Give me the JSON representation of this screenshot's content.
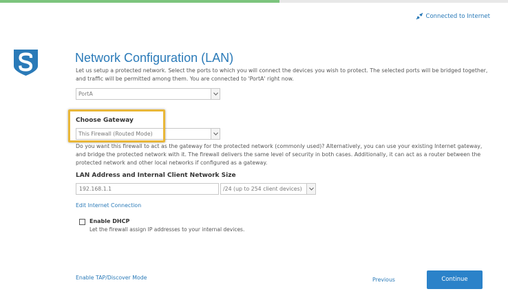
{
  "wizard": {
    "progress_fraction": 0.55
  },
  "header": {
    "connection_status": "Connected to Internet"
  },
  "page": {
    "title": "Network Configuration (LAN)",
    "intro": "Let us setup a protected network. Select the ports to which you will connect the devices you wish to protect. The selected ports will be bridged together, and traffic will be permitted among them. You are connected to 'PortA' right now."
  },
  "ports": {
    "selected": "PortA"
  },
  "gateway": {
    "label": "Choose Gateway",
    "selected": "This Firewall (Routed Mode)",
    "description": "Do you want this firewall to act as the gateway for the protected network (commonly used)? Alternatively, you can use your existing Internet gateway, and bridge the protected network with it. The firewall delivers the same level of security in both cases. Additionally, it can act as a router between the protected network and other local networks if configured as a gateway."
  },
  "lan": {
    "label": "LAN Address and Internal Client Network Size",
    "ip_value": "192.168.1.1",
    "subnet_selected": "/24 (up to 254 client devices)"
  },
  "links": {
    "edit_internet": "Edit Internet Connection",
    "tap_mode": "Enable TAP/Discover Mode"
  },
  "dhcp": {
    "label": "Enable DHCP",
    "help": "Let the firewall assign IP addresses to your internal devices.",
    "checked": false
  },
  "footer": {
    "previous": "Previous",
    "continue": "Continue"
  },
  "colors": {
    "accent": "#2a7ab8",
    "button": "#2b82c9",
    "progress": "#7cc47d",
    "highlight": "#e9b738"
  },
  "icons": {
    "connection": "connected-plug-icon",
    "logo": "sophos-shield-logo",
    "dropdown": "chevron-down-icon"
  }
}
